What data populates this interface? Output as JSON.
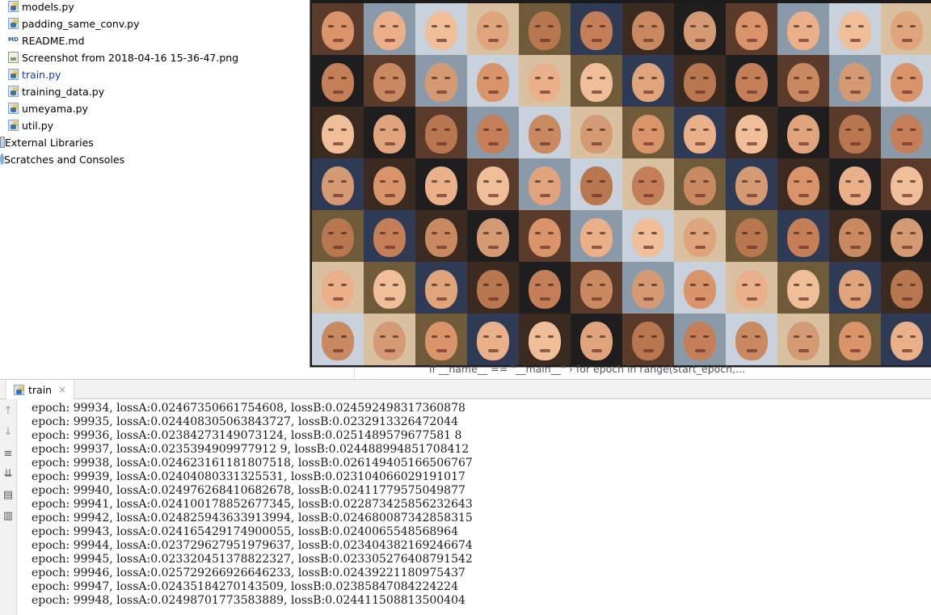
{
  "project_tree": {
    "items": [
      {
        "label": "models.py",
        "icon": "python-file-icon",
        "color": "#000000"
      },
      {
        "label": "padding_same_conv.py",
        "icon": "python-file-icon",
        "color": "#000000"
      },
      {
        "label": "README.md",
        "icon": "markdown-file-icon",
        "color": "#000000"
      },
      {
        "label": "Screenshot from 2018-04-16 15-36-47.png",
        "icon": "image-file-icon",
        "color": "#000000"
      },
      {
        "label": "train.py",
        "icon": "python-file-icon",
        "color": "#1d3ba5"
      },
      {
        "label": "training_data.py",
        "icon": "python-file-icon",
        "color": "#000000"
      },
      {
        "label": "umeyama.py",
        "icon": "python-file-icon",
        "color": "#000000"
      },
      {
        "label": "util.py",
        "icon": "python-file-icon",
        "color": "#000000"
      },
      {
        "label": "External Libraries",
        "icon": "library-icon",
        "color": "#000000"
      },
      {
        "label": "Scratches and Consoles",
        "icon": "scratches-icon",
        "color": "#000000"
      }
    ]
  },
  "viewer": {
    "grid_rows": 7,
    "grid_cols": 12,
    "description_icon": "face-thumbnail-grid"
  },
  "editor_breadcrumb": {
    "text": "if __name__ == \"__main__\"  ›  for epoch in range(start_epoch,..."
  },
  "run_window": {
    "tab_label": "train",
    "tab_close": "×",
    "toolbar_icons": [
      "up-arrow-icon",
      "down-arrow-icon",
      "soft-wrap-icon",
      "scroll-to-end-icon",
      "print-icon",
      "trash-icon"
    ],
    "console_lines": [
      "epoch: 99934, lossA:0.02467350661754608, lossB:0.024592498317360878",
      "epoch: 99935, lossA:0.024408305063843727, lossB:0.0232913326472044",
      "epoch: 99936, lossA:0.02384273149073124, lossB:0.0251489579677581 8",
      "epoch: 99937, lossA:0.0235394909977912 9, lossB:0.024488994851708412",
      "epoch: 99938, lossA:0.024623161181807518, lossB:0.026149405166506767",
      "epoch: 99939, lossA:0.02404080331325531, lossB:0.023104066029191017",
      "epoch: 99940, lossA:0.024976268410682678, lossB:0.02411779575049877",
      "epoch: 99941, lossA:0.024100178852677345, lossB:0.022873425856232643",
      "epoch: 99942, lossA:0.024825943633913994, lossB:0.024680087342858315",
      "epoch: 99943, lossA:0.024165429174900055, lossB:0.0240065548568964",
      "epoch: 99944, lossA:0.023729627951979637, lossB:0.023404382169246674",
      "epoch: 99945, lossA:0.023320451378822327, lossB:0.023305276408791542",
      "epoch: 99946, lossA:0.025729266926646233, lossB:0.02439221180975437",
      "epoch: 99947, lossA:0.02435184270143509, lossB:0.02385847084224224",
      "epoch: 99948, lossA:0.02498701773583889, lossB:0.024411508813500404"
    ]
  }
}
